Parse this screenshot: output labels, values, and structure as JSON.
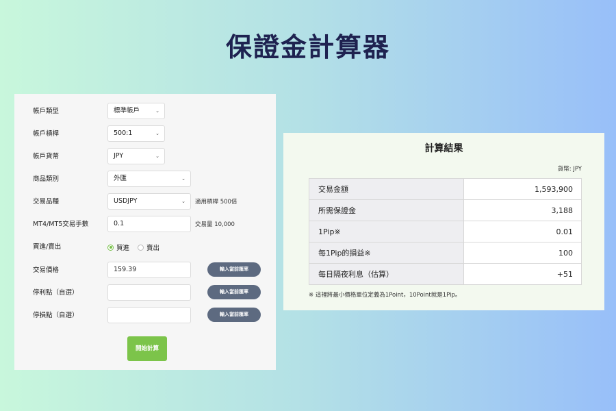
{
  "page": {
    "title": "保證金計算器"
  },
  "form": {
    "account_type": {
      "label": "帳戶類型",
      "value": "標準帳戶"
    },
    "leverage": {
      "label": "帳戶槓桿",
      "value": "500:1"
    },
    "currency": {
      "label": "帳戶貨幣",
      "value": "JPY"
    },
    "product_category": {
      "label": "商品類別",
      "value": "外匯"
    },
    "symbol": {
      "label": "交易品種",
      "value": "USDJPY",
      "note": "適用槓桿 500倍"
    },
    "lots": {
      "label": "MT4/MT5交易手數",
      "value": "0.1",
      "note": "交易量 10,000"
    },
    "direction": {
      "label": "買進/賣出",
      "buy": "買進",
      "sell": "賣出",
      "selected": "buy"
    },
    "price": {
      "label": "交易價格",
      "value": "159.39",
      "button": "輸入當前匯率"
    },
    "take_profit": {
      "label": "停利點（自選）",
      "value": "",
      "button": "輸入當前匯率"
    },
    "stop_loss": {
      "label": "停損點（自選）",
      "value": "",
      "button": "輸入當前匯率"
    },
    "calculate_button": "開始計算"
  },
  "result": {
    "title": "計算結果",
    "currency_note": "貨幣: JPY",
    "rows": [
      {
        "label": "交易金額",
        "value": "1,593,900"
      },
      {
        "label": "所需保證金",
        "value": "3,188"
      },
      {
        "label": "1Pip※",
        "value": "0.01"
      },
      {
        "label": "每1Pip的損益※",
        "value": "100"
      },
      {
        "label": "每日隔夜利息（估算）",
        "value": "+51"
      }
    ],
    "footnote": "※ 這裡將最小價格單位定義為1Point，10Point就是1Pip。"
  },
  "colors": {
    "title": "#1e2250",
    "accent_green": "#7cc44a",
    "rate_button": "#5d6a80"
  }
}
